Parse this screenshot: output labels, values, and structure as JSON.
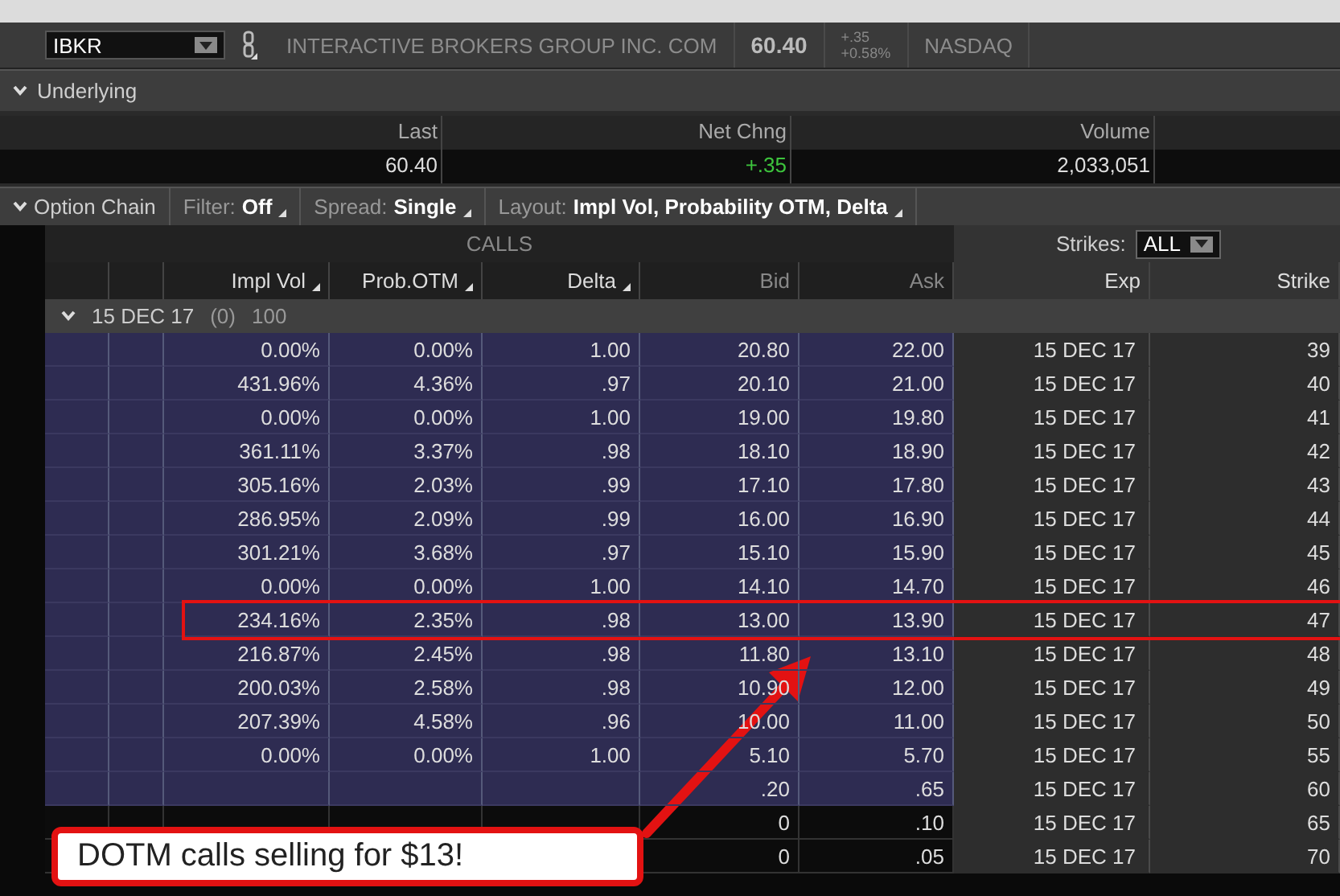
{
  "symbol_bar": {
    "symbol": "IBKR",
    "company": "INTERACTIVE BROKERS GROUP INC. COM",
    "price": "60.40",
    "change": "+.35",
    "change_pct": "+0.58%",
    "exchange": "NASDAQ"
  },
  "underlying": {
    "title": "Underlying",
    "expanded": true,
    "stats": [
      {
        "label": "Last",
        "value": "60.40",
        "kind": "plain"
      },
      {
        "label": "Net Chng",
        "value": "+.35",
        "kind": "up"
      },
      {
        "label": "Volume",
        "value": "2,033,051",
        "kind": "plain"
      }
    ]
  },
  "option_chain": {
    "title": "Option Chain",
    "expanded": true,
    "filters": [
      {
        "label": "Filter:",
        "value": "Off"
      },
      {
        "label": "Spread:",
        "value": "Single"
      },
      {
        "label": "Layout:",
        "value": "Impl Vol, Probability OTM, Delta"
      }
    ]
  },
  "calls_title": "CALLS",
  "strikes": {
    "label": "Strikes:",
    "value": "ALL"
  },
  "columns": [
    {
      "label": "Impl Vol",
      "sortable": true
    },
    {
      "label": "Prob.OTM",
      "sortable": true
    },
    {
      "label": "Delta",
      "sortable": true
    },
    {
      "label": "Bid",
      "sortable": false
    },
    {
      "label": "Ask",
      "sortable": false
    },
    {
      "label": "Exp",
      "sortable": false
    },
    {
      "label": "Strike",
      "sortable": false
    }
  ],
  "expiry": {
    "date": "15 DEC 17",
    "count": "(0)",
    "multiplier": "100",
    "expanded": true
  },
  "rows": [
    {
      "cells": [
        "0.00%",
        "0.00%",
        "1.00",
        "20.80",
        "22.00",
        "15 DEC 17",
        "39"
      ],
      "itm": true,
      "highlighted": false
    },
    {
      "cells": [
        "431.96%",
        "4.36%",
        ".97",
        "20.10",
        "21.00",
        "15 DEC 17",
        "40"
      ],
      "itm": true,
      "highlighted": false
    },
    {
      "cells": [
        "0.00%",
        "0.00%",
        "1.00",
        "19.00",
        "19.80",
        "15 DEC 17",
        "41"
      ],
      "itm": true,
      "highlighted": false
    },
    {
      "cells": [
        "361.11%",
        "3.37%",
        ".98",
        "18.10",
        "18.90",
        "15 DEC 17",
        "42"
      ],
      "itm": true,
      "highlighted": false
    },
    {
      "cells": [
        "305.16%",
        "2.03%",
        ".99",
        "17.10",
        "17.80",
        "15 DEC 17",
        "43"
      ],
      "itm": true,
      "highlighted": false
    },
    {
      "cells": [
        "286.95%",
        "2.09%",
        ".99",
        "16.00",
        "16.90",
        "15 DEC 17",
        "44"
      ],
      "itm": true,
      "highlighted": false
    },
    {
      "cells": [
        "301.21%",
        "3.68%",
        ".97",
        "15.10",
        "15.90",
        "15 DEC 17",
        "45"
      ],
      "itm": true,
      "highlighted": false
    },
    {
      "cells": [
        "0.00%",
        "0.00%",
        "1.00",
        "14.10",
        "14.70",
        "15 DEC 17",
        "46"
      ],
      "itm": true,
      "highlighted": false
    },
    {
      "cells": [
        "234.16%",
        "2.35%",
        ".98",
        "13.00",
        "13.90",
        "15 DEC 17",
        "47"
      ],
      "itm": true,
      "highlighted": true
    },
    {
      "cells": [
        "216.87%",
        "2.45%",
        ".98",
        "11.80",
        "13.10",
        "15 DEC 17",
        "48"
      ],
      "itm": true,
      "highlighted": false
    },
    {
      "cells": [
        "200.03%",
        "2.58%",
        ".98",
        "10.90",
        "12.00",
        "15 DEC 17",
        "49"
      ],
      "itm": true,
      "highlighted": false
    },
    {
      "cells": [
        "207.39%",
        "4.58%",
        ".96",
        "10.00",
        "11.00",
        "15 DEC 17",
        "50"
      ],
      "itm": true,
      "highlighted": false
    },
    {
      "cells": [
        "0.00%",
        "0.00%",
        "1.00",
        "5.10",
        "5.70",
        "15 DEC 17",
        "55"
      ],
      "itm": true,
      "highlighted": false
    },
    {
      "cells": [
        null,
        null,
        null,
        ".20",
        ".65",
        "15 DEC 17",
        "60"
      ],
      "itm": true,
      "highlighted": false
    },
    {
      "cells": [
        null,
        null,
        null,
        "0",
        ".10",
        "15 DEC 17",
        "65"
      ],
      "itm": false,
      "highlighted": false
    },
    {
      "cells": [
        null,
        null,
        null,
        "0",
        ".05",
        "15 DEC 17",
        "70"
      ],
      "itm": false,
      "highlighted": false
    }
  ],
  "callout": {
    "text": "DOTM calls selling for $13!"
  }
}
